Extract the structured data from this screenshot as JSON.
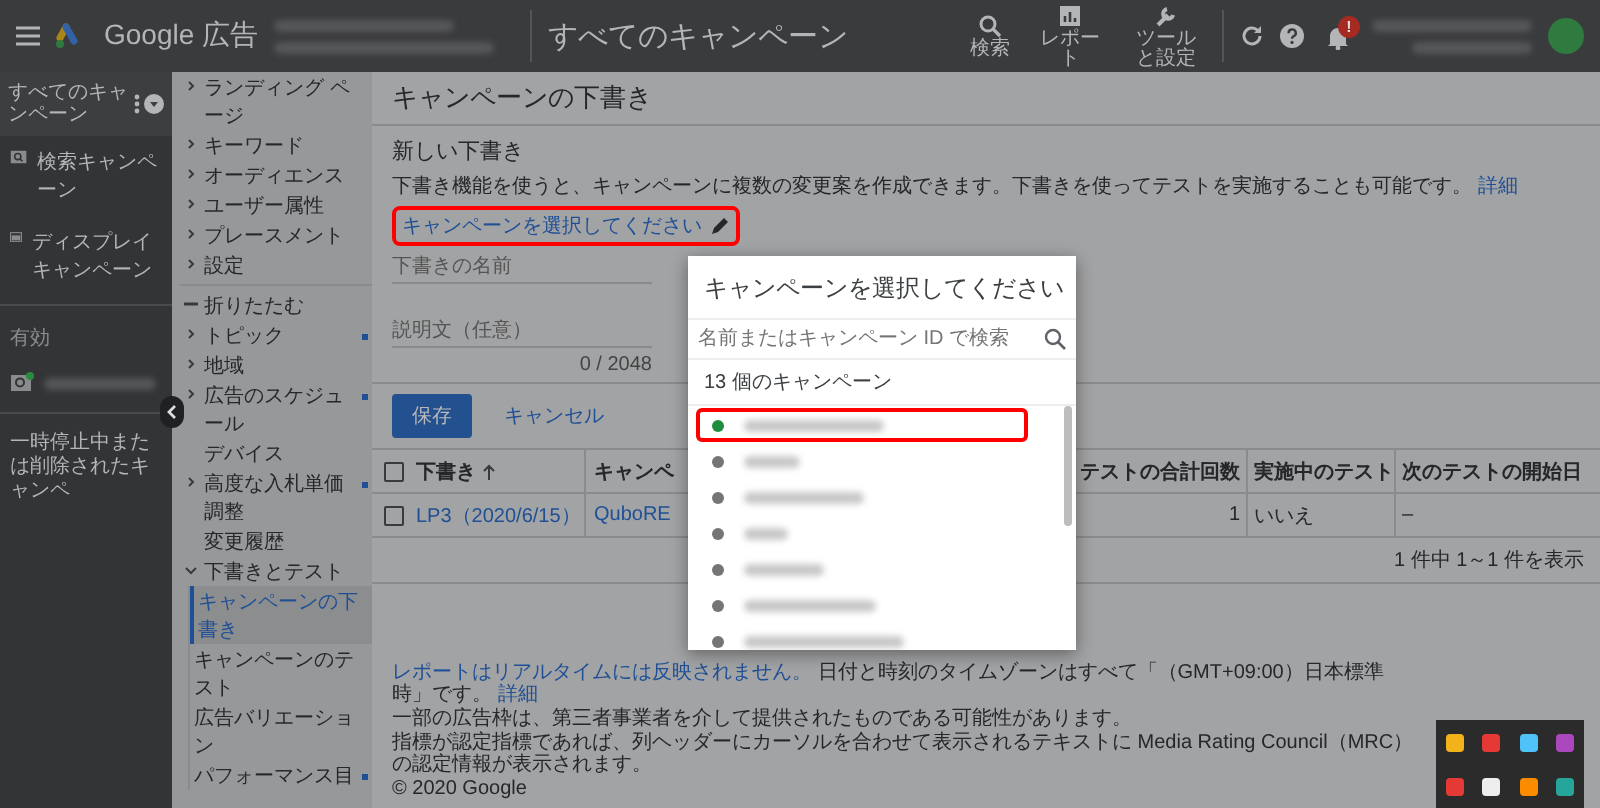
{
  "top_bar": {
    "product": "Google 広告",
    "page_title": "すべてのキャンペーン",
    "tools": [
      {
        "kind": "search",
        "label": "検索"
      },
      {
        "kind": "report",
        "label": "レポート"
      },
      {
        "kind": "tools",
        "label": "ツールと設定"
      }
    ],
    "notification_badge": "!"
  },
  "sidebar": {
    "header": "すべてのキャンペーン",
    "items": [
      {
        "kind": "search",
        "label": "検索キャンペーン"
      },
      {
        "kind": "display",
        "label": "ディスプレイキャンペーン"
      }
    ],
    "section_label": "有効",
    "active_campaigns": [
      {
        "color": "#2e8b3e"
      }
    ],
    "paused_link": "一時停止中または削除されたキャンペ"
  },
  "nav": [
    {
      "kind": "expandable",
      "label": "ランディング ページ",
      "updated": false
    },
    {
      "kind": "expandable",
      "label": "キーワード",
      "updated": false
    },
    {
      "kind": "expandable",
      "label": "オーディエンス",
      "updated": false
    },
    {
      "kind": "expandable",
      "label": "ユーザー属性",
      "updated": false
    },
    {
      "kind": "expandable",
      "label": "プレースメント",
      "updated": false
    },
    {
      "kind": "expandable",
      "label": "設定",
      "updated": false
    },
    {
      "kind": "collapse",
      "label": "折りたたむ",
      "updated": false
    },
    {
      "kind": "expandable",
      "label": "トピック",
      "updated": true
    },
    {
      "kind": "expandable",
      "label": "地域",
      "updated": false
    },
    {
      "kind": "expandable",
      "label": "広告のスケジュール",
      "updated": true
    },
    {
      "kind": "plain",
      "label": "デバイス",
      "updated": false
    },
    {
      "kind": "expandable",
      "label": "高度な入札単価調整",
      "updated": true
    },
    {
      "kind": "plain",
      "label": "変更履歴",
      "updated": false
    },
    {
      "kind": "section",
      "label": "下書きとテスト",
      "updated": false,
      "children": [
        {
          "label": "キャンペーンの下書き",
          "selected": true,
          "updated": false
        },
        {
          "label": "キャンペーンのテスト",
          "selected": false,
          "updated": false
        },
        {
          "label": "広告バリエーション",
          "selected": false,
          "updated": false
        },
        {
          "label": "パフォーマンス目",
          "selected": false,
          "updated": true
        }
      ]
    }
  ],
  "main": {
    "title": "キャンペーンの下書き",
    "card": {
      "heading": "新しい下書き",
      "description": "下書き機能を使うと、キャンペーンに複数の変更案を作成できます。下書きを使ってテストを実施することも可能です。",
      "learn_more": "詳細",
      "campaign_picker": {
        "label": "キャンペーンを選択してください",
        "highlighted": true
      },
      "name_field": {
        "placeholder": "下書きの名前"
      },
      "description_field": {
        "placeholder": "説明文（任意）",
        "counter": "0 / 2048"
      },
      "save": "保存",
      "cancel": "キャンセル"
    },
    "table": {
      "header_checked": false,
      "columns": [
        {
          "label": "下書き",
          "sorted": true
        },
        {
          "label": "キャンペ",
          "sorted": false
        },
        {
          "label": "テストの合計回数",
          "sorted": false
        },
        {
          "label": "実施中のテスト",
          "sorted": false
        },
        {
          "label": "次のテストの開始日",
          "sorted": false
        }
      ],
      "rows": [
        {
          "checked": false,
          "cells": [
            "LP3（2020/6/15）",
            "QuboRE",
            "1",
            "いいえ",
            "–"
          ]
        }
      ],
      "pagination": "1 件中 1～1 件を表示"
    },
    "footer": {
      "notice_link": "レポートはリアルタイムには反映されません。",
      "notice": "日付と時刻のタイムゾーンはすべて「（GMT+09:00）日本標準時」です。",
      "learn_more": "詳細",
      "lines": [
        "一部の広告枠は、第三者事業者を介して提供されたものである可能性があります。",
        "指標が認定指標であれば、列ヘッダーにカーソルを合わせて表示されるテキストに Media Rating Council（MRC）の認定情報が表示されます。"
      ],
      "copyright": "© 2020 Google"
    }
  },
  "dialog": {
    "title": "キャンペーンを選択してください",
    "search": {
      "placeholder": "名前またはキャンペーン ID で検索"
    },
    "count": "13 個のキャンペーン",
    "campaigns": [
      {
        "color": "#1e8e3e",
        "highlighted": true
      },
      {
        "color": "#757575",
        "highlighted": false
      },
      {
        "color": "#757575",
        "highlighted": false
      },
      {
        "color": "#757575",
        "highlighted": false
      },
      {
        "color": "#757575",
        "highlighted": false
      },
      {
        "color": "#757575",
        "highlighted": false
      },
      {
        "color": "#757575",
        "highlighted": false
      }
    ]
  },
  "tray_icons": [
    {
      "color": "#f2b21a"
    },
    {
      "color": "#e53935"
    },
    {
      "color": "#4fc3f7"
    },
    {
      "color": "#ab47bc"
    },
    {
      "color": "#e53935"
    },
    {
      "color": "#eeeeee"
    },
    {
      "color": "#fb8c00"
    },
    {
      "color": "#26a69a"
    }
  ]
}
